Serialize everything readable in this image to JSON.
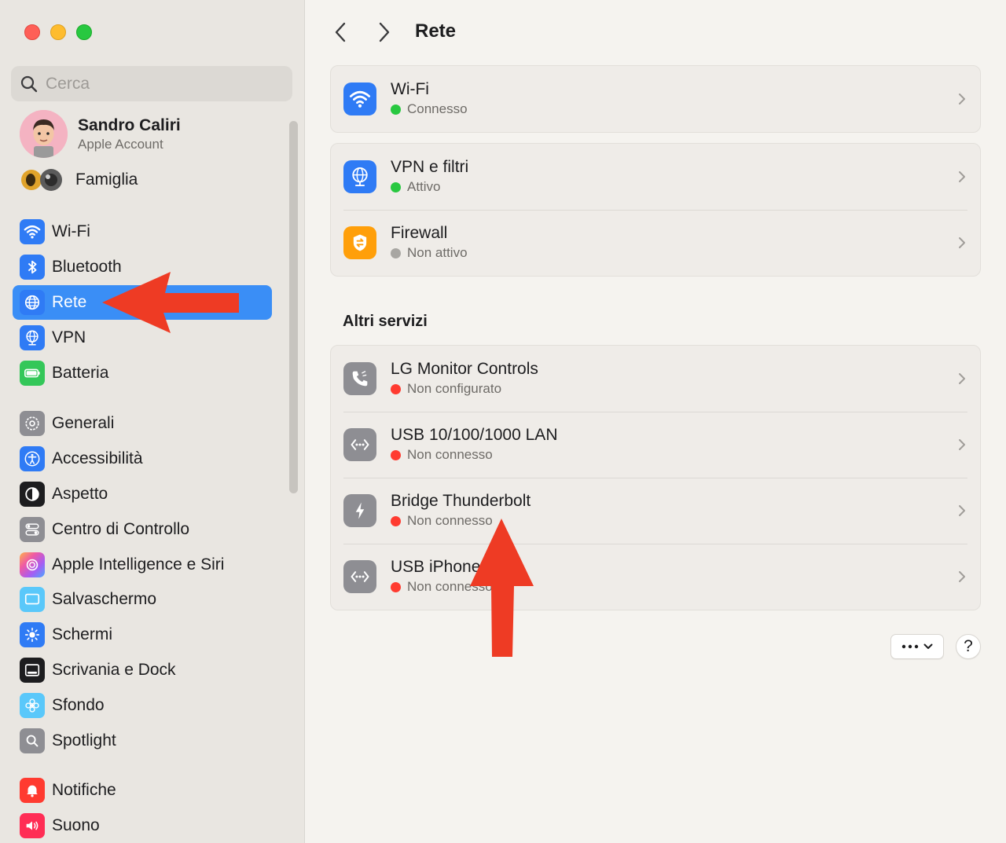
{
  "window": {
    "title": "Rete"
  },
  "search": {
    "placeholder": "Cerca"
  },
  "account": {
    "name": "Sandro Caliri",
    "subtitle": "Apple Account"
  },
  "family": {
    "label": "Famiglia"
  },
  "sidebar": {
    "group1": [
      {
        "label": "Wi-Fi",
        "icon": "wifi-icon",
        "color": "#2f7bf5"
      },
      {
        "label": "Bluetooth",
        "icon": "bluetooth-icon",
        "color": "#2f7bf5"
      },
      {
        "label": "Rete",
        "icon": "globe-icon",
        "color": "#2f7bf5",
        "active": true
      },
      {
        "label": "VPN",
        "icon": "vpn-globe-icon",
        "color": "#2f7bf5"
      },
      {
        "label": "Batteria",
        "icon": "battery-icon",
        "color": "#34c759"
      }
    ],
    "group2": [
      {
        "label": "Generali",
        "icon": "gear-icon",
        "color": "#8e8e93"
      },
      {
        "label": "Accessibilità",
        "icon": "accessibility-icon",
        "color": "#2f7bf5"
      },
      {
        "label": "Aspetto",
        "icon": "appearance-icon",
        "color": "#1d1d1f"
      },
      {
        "label": "Centro di Controllo",
        "icon": "control-center-icon",
        "color": "#8e8e93"
      },
      {
        "label": "Apple Intelligence e Siri",
        "icon": "siri-icon",
        "color": "#e36ad6"
      },
      {
        "label": "Salvaschermo",
        "icon": "screensaver-icon",
        "color": "#5ac8fa"
      },
      {
        "label": "Schermi",
        "icon": "sun-icon",
        "color": "#2f7bf5"
      },
      {
        "label": "Scrivania e Dock",
        "icon": "dock-icon",
        "color": "#1d1d1f"
      },
      {
        "label": "Sfondo",
        "icon": "flower-icon",
        "color": "#5ac8fa"
      },
      {
        "label": "Spotlight",
        "icon": "spotlight-icon",
        "color": "#8e8e93"
      }
    ],
    "group3": [
      {
        "label": "Notifiche",
        "icon": "bell-icon",
        "color": "#ff3b30"
      },
      {
        "label": "Suono",
        "icon": "speaker-icon",
        "color": "#ff2d55"
      }
    ]
  },
  "main": {
    "wifi": {
      "title": "Wi-Fi",
      "status": "Connesso",
      "status_color": "#28c840"
    },
    "vpn_card": [
      {
        "title": "VPN e filtri",
        "status": "Attivo",
        "status_color": "#28c840"
      },
      {
        "title": "Firewall",
        "status": "Non attivo",
        "status_color": "#a8a6a2"
      }
    ],
    "section_title": "Altri servizi",
    "services": [
      {
        "title": "LG Monitor Controls",
        "status": "Non configurato",
        "status_color": "#ff3b30",
        "icon": "phone-icon"
      },
      {
        "title": "USB 10/100/1000 LAN",
        "status": "Non connesso",
        "status_color": "#ff3b30",
        "icon": "ethernet-icon"
      },
      {
        "title": "Bridge Thunderbolt",
        "status": "Non connesso",
        "status_color": "#ff3b30",
        "icon": "thunderbolt-icon"
      },
      {
        "title": "USB iPhone",
        "status": "Non connesso",
        "status_color": "#ff3b30",
        "icon": "ethernet-icon"
      }
    ],
    "help_label": "?"
  },
  "annotations": {
    "arrow_color": "#ee3b24"
  }
}
